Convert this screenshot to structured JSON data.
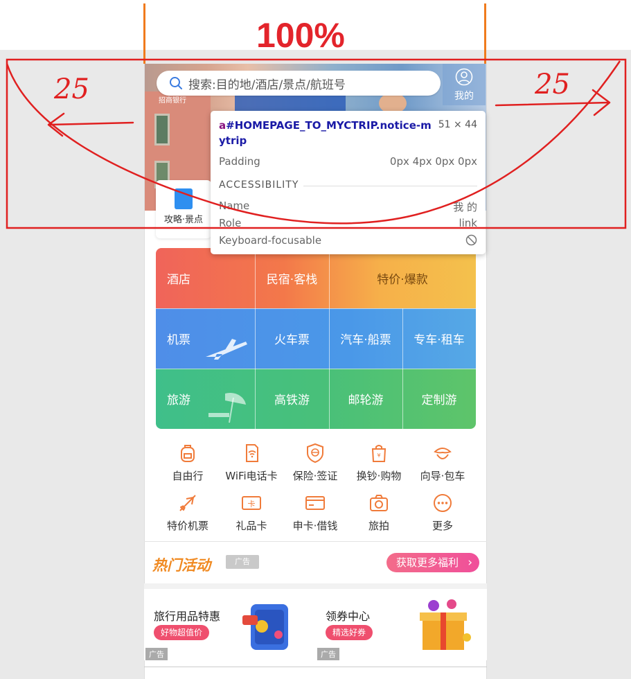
{
  "annotation": {
    "zoom_label": "100%",
    "left_margin": "25",
    "right_margin": "25"
  },
  "header": {
    "search_placeholder": "搜索:目的地/酒店/景点/航班号",
    "mytrip_label": "我的",
    "guide_label": "攻略·景点"
  },
  "hero": {
    "bank_text": "招商银行"
  },
  "tooltip": {
    "selector_tag": "a",
    "selector_rest": "#HOMEPAGE_TO_MYCTRIP.notice-mytrip",
    "dimensions": "51 × 44",
    "padding_label": "Padding",
    "padding_value": "0px 4px 0px 0px",
    "section_title": "ACCESSIBILITY",
    "name_label": "Name",
    "name_value": "我 的",
    "role_label": "Role",
    "role_value": "link",
    "focusable_label": "Keyboard-focusable"
  },
  "tiles": {
    "row1": [
      "酒店",
      "民宿·客栈",
      "特价·爆款"
    ],
    "row2": [
      "机票",
      "火车票",
      "汽车·船票",
      "专车·租车"
    ],
    "row3": [
      "旅游",
      "高铁游",
      "邮轮游",
      "定制游"
    ]
  },
  "tile_colors": {
    "hotel": "#f0645a",
    "flight": "#4f8ee8",
    "travel": "#48c07a"
  },
  "icons": [
    {
      "label": "自由行",
      "icon": "backpack-icon"
    },
    {
      "label": "WiFi电话卡",
      "icon": "wifi-card-icon"
    },
    {
      "label": "保险·签证",
      "icon": "shield-globe-icon"
    },
    {
      "label": "换钞·购物",
      "icon": "shopping-bag-icon"
    },
    {
      "label": "向导·包车",
      "icon": "guide-icon"
    },
    {
      "label": "特价机票",
      "icon": "plane-icon"
    },
    {
      "label": "礼品卡",
      "icon": "gift-card-icon"
    },
    {
      "label": "申卡·借钱",
      "icon": "credit-card-icon"
    },
    {
      "label": "旅拍",
      "icon": "camera-icon"
    },
    {
      "label": "更多",
      "icon": "more-icon"
    }
  ],
  "hot": {
    "title": "热门活动",
    "ad_badge": "广告",
    "more_button": "获取更多福利"
  },
  "promos": [
    {
      "title": "旅行用品特惠",
      "pill": "好物超值价",
      "ad": "广告"
    },
    {
      "title": "领券中心",
      "pill": "精选好券",
      "ad": "广告"
    }
  ]
}
